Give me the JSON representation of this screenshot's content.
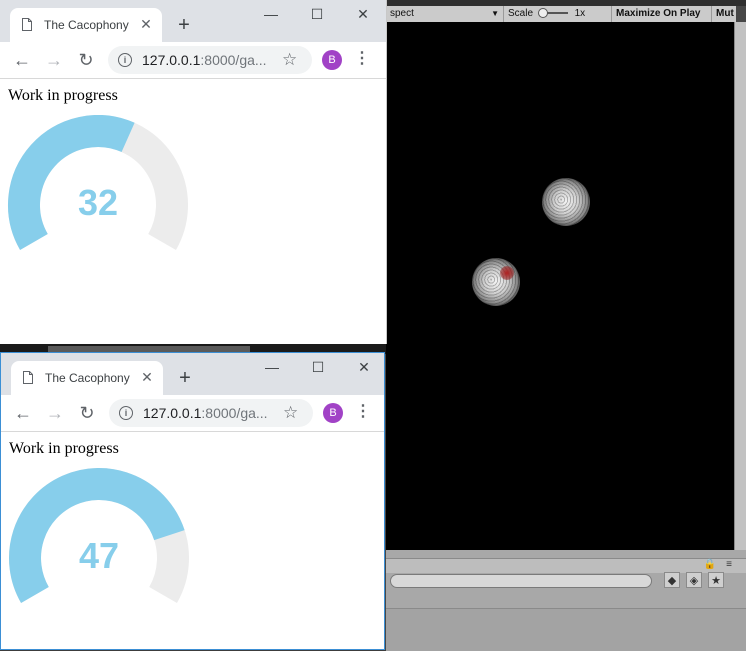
{
  "unity": {
    "toolbar": {
      "aspect_label": "spect",
      "scale_label": "Scale",
      "scale_value": "1x",
      "maximize_label": "Maximize On Play",
      "mute_label": "Mut"
    }
  },
  "windows": [
    {
      "tab_title": "The Cacophony",
      "url_host": "127.0.0.1",
      "url_rest": ":8000/ga...",
      "avatar_letter": "B",
      "heading": "Work in progress",
      "gauge_value": "32",
      "gauge_fraction": 0.6
    },
    {
      "tab_title": "The Cacophony",
      "url_host": "127.0.0.1",
      "url_rest": ":8000/ga...",
      "avatar_letter": "B",
      "heading": "Work in progress",
      "gauge_value": "47",
      "gauge_fraction": 0.8
    }
  ],
  "colors": {
    "gauge_fill": "#87ceeb",
    "gauge_track": "#ececec",
    "avatar": "#a142c6"
  },
  "icons": [
    "document-icon",
    "close-icon",
    "plus-icon",
    "minimize-icon",
    "maximize-icon",
    "window-close-icon",
    "back-arrow-icon",
    "forward-arrow-icon",
    "reload-icon",
    "info-icon",
    "star-icon",
    "kebab-menu-icon"
  ]
}
